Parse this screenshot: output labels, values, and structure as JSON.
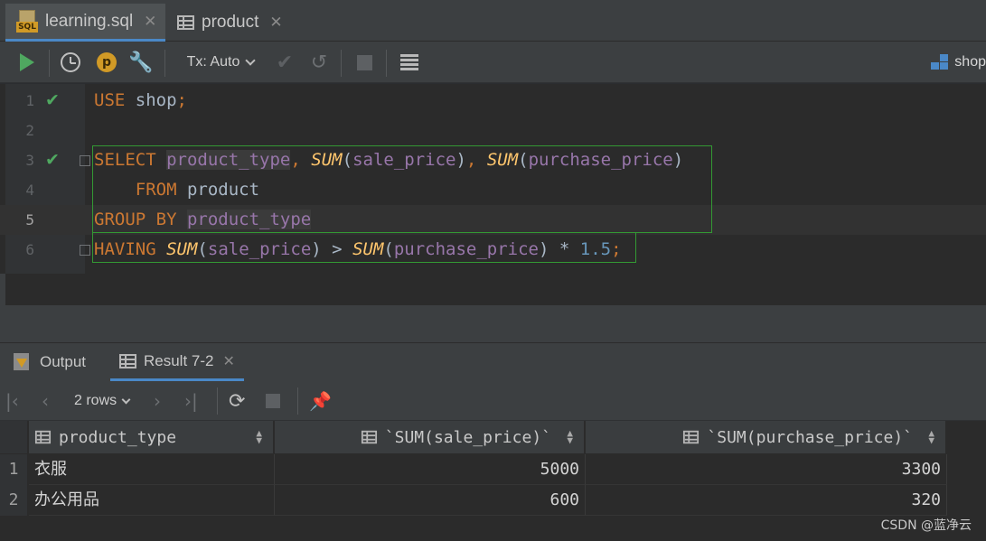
{
  "editor_tabs": [
    {
      "label": "learning.sql",
      "icon": "sql-file-icon",
      "active": true
    },
    {
      "label": "product",
      "icon": "table-icon",
      "active": false
    }
  ],
  "toolbar": {
    "tx_mode": "Tx: Auto",
    "schema": "shop"
  },
  "code_lines": [
    {
      "num": "1",
      "status": "ok"
    },
    {
      "num": "2",
      "status": ""
    },
    {
      "num": "3",
      "status": "ok"
    },
    {
      "num": "4",
      "status": ""
    },
    {
      "num": "5",
      "status": "",
      "current": true
    },
    {
      "num": "6",
      "status": ""
    }
  ],
  "code": {
    "l1": {
      "kw": "USE",
      "name": "shop",
      "end": ";"
    },
    "l3": {
      "kw": "SELECT",
      "c1": "product_type",
      "comma": ",",
      "f1": "SUM",
      "c2": "sale_price",
      "f2": "SUM",
      "c3": "purchase_price"
    },
    "l4": {
      "kw": "FROM",
      "table": "product"
    },
    "l5": {
      "kw": "GROUP BY",
      "c1": "product_type"
    },
    "l6": {
      "kw": "HAVING",
      "f1": "SUM",
      "c1": "sale_price",
      "op": ">",
      "f2": "SUM",
      "c2": "purchase_price",
      "op2": "*",
      "num": "1.5",
      "end": ";"
    }
  },
  "result_tabs": {
    "output_label": "Output",
    "result_label": "Result 7-2"
  },
  "result_toolbar": {
    "rows_label": "2 rows"
  },
  "table": {
    "columns": [
      "product_type",
      "`SUM(sale_price)`",
      "`SUM(purchase_price)`"
    ],
    "rows": [
      {
        "num": "1",
        "cells": [
          "衣服",
          "5000",
          "3300"
        ]
      },
      {
        "num": "2",
        "cells": [
          "办公用品",
          "600",
          "320"
        ]
      }
    ]
  },
  "watermark": "CSDN @蓝净云",
  "colors": {
    "keyword": "#cc7832",
    "function": "#ffc66d",
    "column": "#9876aa",
    "number": "#6897bb",
    "ok": "#4fa860",
    "accent": "#4a88c7"
  }
}
